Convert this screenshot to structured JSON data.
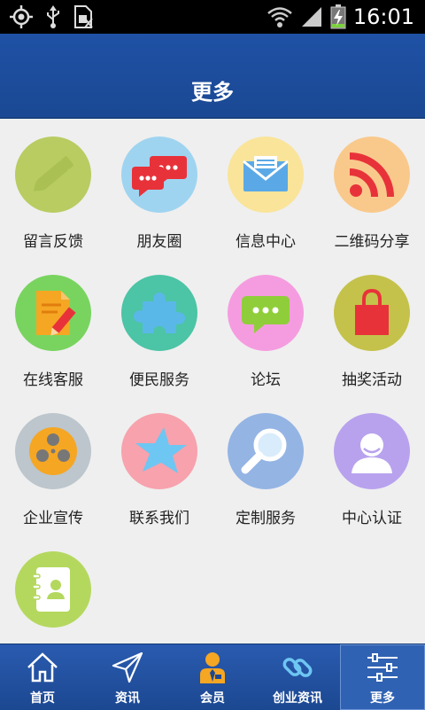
{
  "status_bar": {
    "time": "16:01",
    "icons": [
      "gps-icon",
      "usb-icon",
      "sim-icon",
      "wifi-icon",
      "signal-icon",
      "battery-charging-icon"
    ]
  },
  "header": {
    "title": "更多"
  },
  "grid": {
    "items": [
      {
        "label": "留言反馈",
        "icon": "pencil-icon",
        "color": "#b8cc62"
      },
      {
        "label": "朋友圈",
        "icon": "chat-bubbles-icon",
        "color": "#9fd4f0"
      },
      {
        "label": "信息中心",
        "icon": "envelope-icon",
        "color": "#f9e49a"
      },
      {
        "label": "二维码分享",
        "icon": "rss-icon",
        "color": "#f9c98c"
      },
      {
        "label": "在线客服",
        "icon": "document-edit-icon",
        "color": "#78d45f"
      },
      {
        "label": "便民服务",
        "icon": "puzzle-icon",
        "color": "#4cc4a6"
      },
      {
        "label": "论坛",
        "icon": "speech-bubble-icon",
        "color": "#f59ce0"
      },
      {
        "label": "抽奖活动",
        "icon": "shopping-bag-icon",
        "color": "#c4c24a"
      },
      {
        "label": "企业宣传",
        "icon": "film-reel-icon",
        "color": "#bcc6cc"
      },
      {
        "label": "联系我们",
        "icon": "star-icon",
        "color": "#f7a2ad"
      },
      {
        "label": "定制服务",
        "icon": "magnifier-icon",
        "color": "#94b4e4"
      },
      {
        "label": "中心认证",
        "icon": "user-icon",
        "color": "#b8a2ee"
      },
      {
        "label": "",
        "icon": "address-book-icon",
        "color": "#b4d85e"
      }
    ]
  },
  "tab_bar": {
    "active_index": 4,
    "tabs": [
      {
        "label": "首页",
        "icon": "home-icon"
      },
      {
        "label": "资讯",
        "icon": "paper-plane-icon"
      },
      {
        "label": "会员",
        "icon": "member-icon"
      },
      {
        "label": "创业资讯",
        "icon": "link-icon"
      },
      {
        "label": "更多",
        "icon": "sliders-icon"
      }
    ]
  }
}
